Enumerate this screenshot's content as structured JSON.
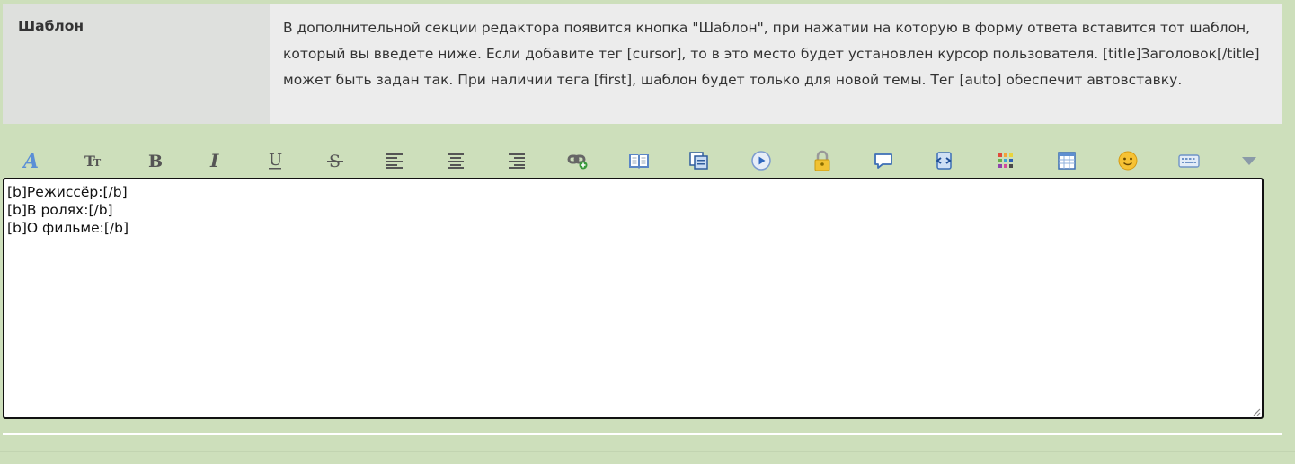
{
  "setting": {
    "label": "Шаблон",
    "description": "В дополнительной секции редактора появится кнопка \"Шаблон\", при нажатии на которую в форму ответа вставится тот шаблон, который вы введете ниже. Если добавите тег [cursor], то в это место будет установлен курсор пользователя. [title]Заголовок[/title] может быть задан так. При наличии тега [first], шаблон будет только для новой темы. Тег [auto] обеспечит автовставку."
  },
  "toolbar": {
    "buttons": [
      {
        "name": "font-icon"
      },
      {
        "name": "font-size-icon"
      },
      {
        "name": "bold-icon"
      },
      {
        "name": "italic-icon"
      },
      {
        "name": "underline-icon"
      },
      {
        "name": "strikethrough-icon"
      },
      {
        "name": "align-left-icon"
      },
      {
        "name": "align-center-icon"
      },
      {
        "name": "align-right-icon"
      },
      {
        "name": "link-icon"
      },
      {
        "name": "book-icon"
      },
      {
        "name": "copy-icon"
      },
      {
        "name": "play-icon"
      },
      {
        "name": "lock-icon"
      },
      {
        "name": "speech-bubble-icon"
      },
      {
        "name": "scroll-icon"
      },
      {
        "name": "color-palette-icon"
      },
      {
        "name": "table-icon"
      },
      {
        "name": "smiley-icon"
      },
      {
        "name": "keyboard-icon"
      },
      {
        "name": "dropdown-arrow-icon"
      }
    ]
  },
  "editor": {
    "value": "[b]Режиссёр:[/b]\n[b]В ролях:[/b]\n[b]О фильме:[/b]"
  }
}
